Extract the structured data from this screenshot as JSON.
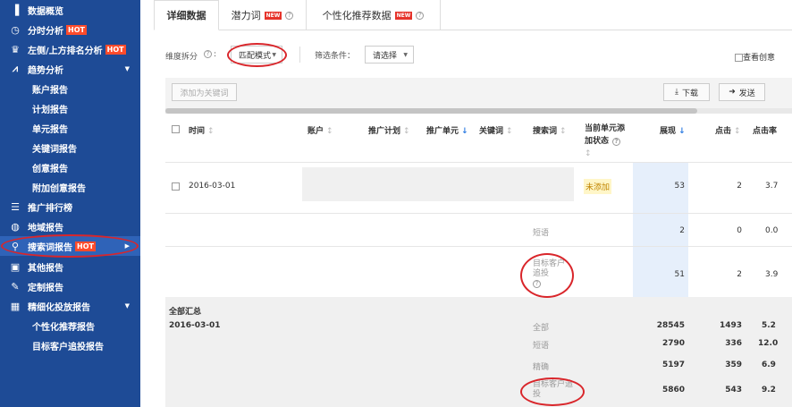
{
  "sidebar": {
    "items": [
      {
        "icon": "bar-chart-icon",
        "glyph": "▐",
        "label": "数据概览",
        "hot": ""
      },
      {
        "icon": "clock-icon",
        "glyph": "◷",
        "label": "分时分析",
        "hot": "HOT"
      },
      {
        "icon": "trophy-icon",
        "glyph": "♛",
        "label": "左侧/上方排名分析",
        "hot": "HOT"
      },
      {
        "icon": "trend-icon",
        "glyph": "⩘",
        "label": "趋势分析",
        "hot": ""
      },
      {
        "label": "账户报告"
      },
      {
        "label": "计划报告"
      },
      {
        "label": "单元报告"
      },
      {
        "label": "关键词报告"
      },
      {
        "label": "创意报告"
      },
      {
        "label": "附加创意报告"
      },
      {
        "icon": "list-icon",
        "glyph": "☰",
        "label": "推广排行榜",
        "hot": ""
      },
      {
        "icon": "globe-icon",
        "glyph": "◍",
        "label": "地域报告",
        "hot": ""
      },
      {
        "icon": "search-icon",
        "glyph": "⚲",
        "label": "搜索词报告",
        "hot": "HOT"
      },
      {
        "icon": "other-icon",
        "glyph": "▣",
        "label": "其他报告",
        "hot": ""
      },
      {
        "icon": "edit-icon",
        "glyph": "✎",
        "label": "定制报告",
        "hot": ""
      },
      {
        "icon": "calculator-icon",
        "glyph": "▦",
        "label": "精细化投放报告",
        "hot": ""
      },
      {
        "label": "个性化推荐报告"
      },
      {
        "label": "目标客户追投报告"
      }
    ]
  },
  "tabs": [
    {
      "label": "详细数据",
      "badge": ""
    },
    {
      "label": "潜力词",
      "badge": "NEW"
    },
    {
      "label": "个性化推荐数据",
      "badge": "NEW"
    }
  ],
  "filters": {
    "dimension_label": "维度拆分",
    "dimension_value": "匹配模式",
    "filter_label": "筛选条件：",
    "filter_value": "请选择",
    "view_creative": "查看创意"
  },
  "toolbar": {
    "add_keyword": "添加为关键词",
    "download": "下载",
    "send": "发送"
  },
  "table": {
    "headers": {
      "time": "时间",
      "account": "账户",
      "plan": "推广计划",
      "unit": "推广单元",
      "keyword": "关键词",
      "search_term": "搜索词",
      "status_line1": "当前单元添",
      "status_line2": "加状态",
      "impressions": "展现",
      "clicks": "点击",
      "ctr": "点击率"
    },
    "row": {
      "date": "2016-03-01",
      "status": "未添加",
      "impressions": "53",
      "clicks": "2",
      "ctr": "3.7"
    },
    "subrows": [
      {
        "label": "短语",
        "impressions": "2",
        "clicks": "0",
        "ctr": "0.0"
      },
      {
        "label_line1": "目标客户",
        "label_line2": "追投",
        "impressions": "51",
        "clicks": "2",
        "ctr": "3.9"
      }
    ],
    "summary": {
      "title": "全部汇总",
      "date": "2016-03-01",
      "rows": [
        {
          "label": "全部",
          "impressions": "28545",
          "clicks": "1493",
          "ctr": "5.2"
        },
        {
          "label": "短语",
          "impressions": "2790",
          "clicks": "336",
          "ctr": "12.0"
        },
        {
          "label": "精确",
          "impressions": "5197",
          "clicks": "359",
          "ctr": "6.9"
        },
        {
          "label_line1": "目标客户追",
          "label_line2": "投",
          "impressions": "5860",
          "clicks": "543",
          "ctr": "9.2"
        }
      ]
    }
  },
  "colors": {
    "sidebar_bg": "#1e4b96",
    "hot_badge": "#ff4b2b",
    "annotation_red": "#d9262b",
    "highlight_col": "#e6effb"
  }
}
